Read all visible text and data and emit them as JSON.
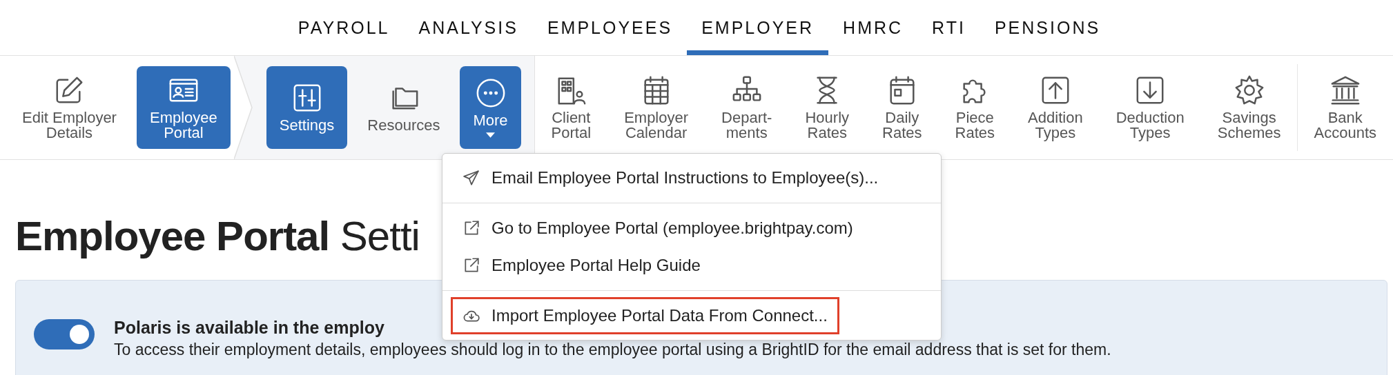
{
  "nav": {
    "tabs": [
      {
        "label": "PAYROLL",
        "selected": false
      },
      {
        "label": "ANALYSIS",
        "selected": false
      },
      {
        "label": "EMPLOYEES",
        "selected": false
      },
      {
        "label": "EMPLOYER",
        "selected": true
      },
      {
        "label": "HMRC",
        "selected": false
      },
      {
        "label": "RTI",
        "selected": false
      },
      {
        "label": "PENSIONS",
        "selected": false
      }
    ]
  },
  "toolbar": {
    "main_items": [
      {
        "label": "Edit Employer\nDetails",
        "selected": false
      },
      {
        "label": "Employee\nPortal",
        "selected": true
      }
    ],
    "sub_items": [
      {
        "label": "Settings",
        "selected": true,
        "kind": "button"
      },
      {
        "label": "Resources",
        "selected": false,
        "kind": "button"
      },
      {
        "label": "More",
        "selected": true,
        "kind": "dropdown",
        "expanded": true
      }
    ],
    "other_items": [
      {
        "label": "Client\nPortal",
        "selected": false
      },
      {
        "label": "Employer\nCalendar",
        "selected": false
      },
      {
        "label": "Depart-\nments",
        "selected": false
      },
      {
        "label": "Hourly\nRates",
        "selected": false
      },
      {
        "label": "Daily\nRates",
        "selected": false
      },
      {
        "label": "Piece\nRates",
        "selected": false
      },
      {
        "label": "Addition\nTypes",
        "selected": false
      },
      {
        "label": "Deduction\nTypes",
        "selected": false
      },
      {
        "label": "Savings\nSchemes",
        "selected": false
      },
      {
        "label": "Bank\nAccounts",
        "selected": false
      }
    ]
  },
  "more_menu": {
    "sections": [
      [
        {
          "label": "Email Employee Portal Instructions to Employee(s)...",
          "kind": "send",
          "highlighted": false
        }
      ],
      [
        {
          "label": "Go to Employee Portal (employee.brightpay.com)",
          "kind": "external",
          "highlighted": false
        },
        {
          "label": "Employee Portal Help Guide",
          "kind": "external",
          "highlighted": false
        }
      ],
      [
        {
          "label": "Import Employee Portal Data From Connect...",
          "kind": "cloud",
          "highlighted": true
        }
      ]
    ]
  },
  "page": {
    "title": "**Employee Portal** Setti"
  },
  "banner": {
    "toggle": {
      "on": true
    },
    "title": "Polaris is available in the employ",
    "text": "To access their employment details, employees should log in to the employee portal using a BrightID for the email address that is set for them."
  }
}
